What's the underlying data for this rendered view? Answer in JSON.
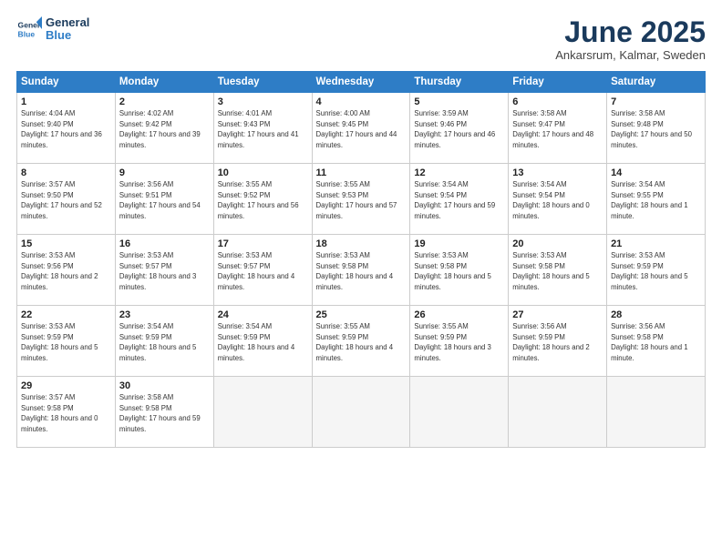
{
  "header": {
    "logo_line1": "General",
    "logo_line2": "Blue",
    "month_title": "June 2025",
    "location": "Ankarsrum, Kalmar, Sweden"
  },
  "weekdays": [
    "Sunday",
    "Monday",
    "Tuesday",
    "Wednesday",
    "Thursday",
    "Friday",
    "Saturday"
  ],
  "weeks": [
    [
      {
        "num": "1",
        "rise": "4:04 AM",
        "set": "9:40 PM",
        "daylight": "17 hours and 36 minutes."
      },
      {
        "num": "2",
        "rise": "4:02 AM",
        "set": "9:42 PM",
        "daylight": "17 hours and 39 minutes."
      },
      {
        "num": "3",
        "rise": "4:01 AM",
        "set": "9:43 PM",
        "daylight": "17 hours and 41 minutes."
      },
      {
        "num": "4",
        "rise": "4:00 AM",
        "set": "9:45 PM",
        "daylight": "17 hours and 44 minutes."
      },
      {
        "num": "5",
        "rise": "3:59 AM",
        "set": "9:46 PM",
        "daylight": "17 hours and 46 minutes."
      },
      {
        "num": "6",
        "rise": "3:58 AM",
        "set": "9:47 PM",
        "daylight": "17 hours and 48 minutes."
      },
      {
        "num": "7",
        "rise": "3:58 AM",
        "set": "9:48 PM",
        "daylight": "17 hours and 50 minutes."
      }
    ],
    [
      {
        "num": "8",
        "rise": "3:57 AM",
        "set": "9:50 PM",
        "daylight": "17 hours and 52 minutes."
      },
      {
        "num": "9",
        "rise": "3:56 AM",
        "set": "9:51 PM",
        "daylight": "17 hours and 54 minutes."
      },
      {
        "num": "10",
        "rise": "3:55 AM",
        "set": "9:52 PM",
        "daylight": "17 hours and 56 minutes."
      },
      {
        "num": "11",
        "rise": "3:55 AM",
        "set": "9:53 PM",
        "daylight": "17 hours and 57 minutes."
      },
      {
        "num": "12",
        "rise": "3:54 AM",
        "set": "9:54 PM",
        "daylight": "17 hours and 59 minutes."
      },
      {
        "num": "13",
        "rise": "3:54 AM",
        "set": "9:54 PM",
        "daylight": "18 hours and 0 minutes."
      },
      {
        "num": "14",
        "rise": "3:54 AM",
        "set": "9:55 PM",
        "daylight": "18 hours and 1 minute."
      }
    ],
    [
      {
        "num": "15",
        "rise": "3:53 AM",
        "set": "9:56 PM",
        "daylight": "18 hours and 2 minutes."
      },
      {
        "num": "16",
        "rise": "3:53 AM",
        "set": "9:57 PM",
        "daylight": "18 hours and 3 minutes."
      },
      {
        "num": "17",
        "rise": "3:53 AM",
        "set": "9:57 PM",
        "daylight": "18 hours and 4 minutes."
      },
      {
        "num": "18",
        "rise": "3:53 AM",
        "set": "9:58 PM",
        "daylight": "18 hours and 4 minutes."
      },
      {
        "num": "19",
        "rise": "3:53 AM",
        "set": "9:58 PM",
        "daylight": "18 hours and 5 minutes."
      },
      {
        "num": "20",
        "rise": "3:53 AM",
        "set": "9:58 PM",
        "daylight": "18 hours and 5 minutes."
      },
      {
        "num": "21",
        "rise": "3:53 AM",
        "set": "9:59 PM",
        "daylight": "18 hours and 5 minutes."
      }
    ],
    [
      {
        "num": "22",
        "rise": "3:53 AM",
        "set": "9:59 PM",
        "daylight": "18 hours and 5 minutes."
      },
      {
        "num": "23",
        "rise": "3:54 AM",
        "set": "9:59 PM",
        "daylight": "18 hours and 5 minutes."
      },
      {
        "num": "24",
        "rise": "3:54 AM",
        "set": "9:59 PM",
        "daylight": "18 hours and 4 minutes."
      },
      {
        "num": "25",
        "rise": "3:55 AM",
        "set": "9:59 PM",
        "daylight": "18 hours and 4 minutes."
      },
      {
        "num": "26",
        "rise": "3:55 AM",
        "set": "9:59 PM",
        "daylight": "18 hours and 3 minutes."
      },
      {
        "num": "27",
        "rise": "3:56 AM",
        "set": "9:59 PM",
        "daylight": "18 hours and 2 minutes."
      },
      {
        "num": "28",
        "rise": "3:56 AM",
        "set": "9:58 PM",
        "daylight": "18 hours and 1 minute."
      }
    ],
    [
      {
        "num": "29",
        "rise": "3:57 AM",
        "set": "9:58 PM",
        "daylight": "18 hours and 0 minutes."
      },
      {
        "num": "30",
        "rise": "3:58 AM",
        "set": "9:58 PM",
        "daylight": "17 hours and 59 minutes."
      },
      null,
      null,
      null,
      null,
      null
    ]
  ],
  "labels": {
    "sunrise": "Sunrise:",
    "sunset": "Sunset:",
    "daylight": "Daylight:"
  }
}
